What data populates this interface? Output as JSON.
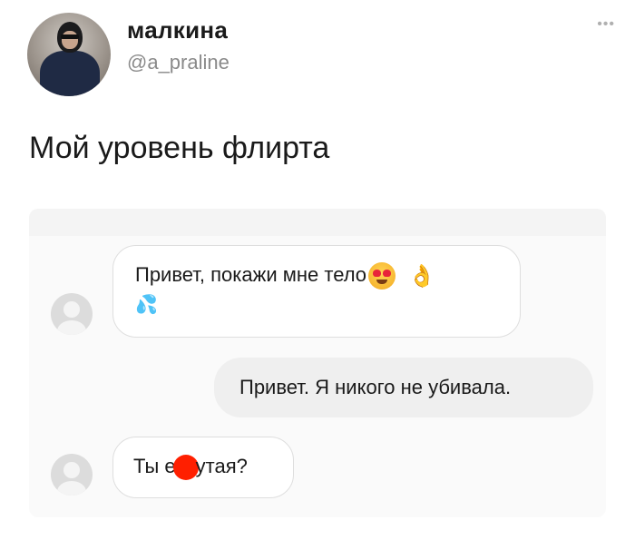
{
  "profile": {
    "name": "малкина",
    "handle": "@a_praline",
    "more_icon": "more-dots-icon"
  },
  "tweet": {
    "text": "Мой уровень флирта"
  },
  "chat": {
    "messages": [
      {
        "direction": "incoming",
        "text": "Привет, покажи мне тело",
        "emojis": [
          "heart-eyes-emoji",
          "ok-hand-emoji",
          "sweat-droplets-emoji"
        ]
      },
      {
        "direction": "outgoing",
        "text": "Привет. Я никого не убивала."
      },
      {
        "direction": "incoming",
        "text_before": "Ты е",
        "text_after": "утая?",
        "censor_color": "#ff1f00"
      }
    ]
  },
  "colors": {
    "incoming_bubble_border": "#dedede",
    "outgoing_bubble_bg": "#efefef",
    "handle_text": "#8a8a8a"
  }
}
